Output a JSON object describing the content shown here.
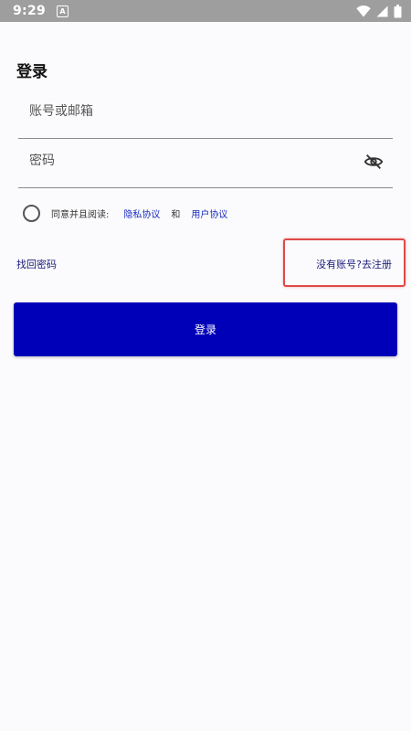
{
  "status_bar": {
    "time": "9:29",
    "notification_glyph": "A",
    "icons": [
      "wifi-icon",
      "signal-icon",
      "battery-icon"
    ]
  },
  "page": {
    "title": "登录"
  },
  "form": {
    "account_placeholder": "账号或邮箱",
    "password_placeholder": "密码",
    "password_toggle_icon": "eye-off-icon"
  },
  "agreement": {
    "prefix": "同意并且阅读:",
    "privacy_link": "隐私协议",
    "conjunction": "和",
    "terms_link": "用户协议"
  },
  "links": {
    "forgot_password": "找回密码",
    "register": "没有账号?去注册"
  },
  "login_button": {
    "label": "登录"
  },
  "colors": {
    "primary": "#0000b8",
    "link": "#1a2dbf",
    "highlight": "#e04848",
    "status_bar": "#9e9e9e",
    "background": "#fbfbfd"
  }
}
